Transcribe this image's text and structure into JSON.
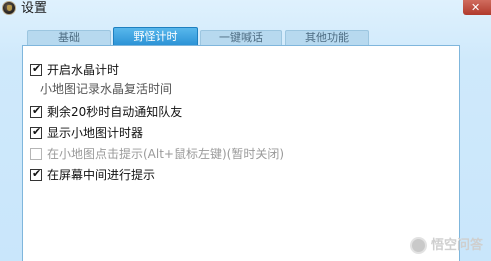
{
  "window": {
    "title": "设置",
    "close_glyph": "✕",
    "icon": "game-app-icon"
  },
  "tabs": [
    {
      "label": "基础",
      "active": false
    },
    {
      "label": "野怪计时",
      "active": true
    },
    {
      "label": "一键喊话",
      "active": false
    },
    {
      "label": "其他功能",
      "active": false
    }
  ],
  "options": [
    {
      "label": "开启水晶计时",
      "checked": true,
      "enabled": true
    },
    {
      "label": "小地图记录水晶复活时间"
    },
    {
      "label": "剩余20秒时自动通知队友",
      "checked": true,
      "enabled": true
    },
    {
      "label": "显示小地图计时器",
      "checked": true,
      "enabled": true
    },
    {
      "label": "在小地图点击提示(Alt+鼠标左键)(暂时关闭)",
      "checked": false,
      "enabled": false
    },
    {
      "label": "在屏幕中间进行提示",
      "checked": true,
      "enabled": true
    }
  ],
  "check_glyph": "✔",
  "watermark": {
    "text": "悟空问答",
    "icon": "wukong-logo-icon"
  },
  "colors": {
    "window_bg": "#cfe9fb",
    "active_tab": "#2c93d6",
    "inactive_tab": "#b7d9ef",
    "panel_border": "#7fb6dc",
    "close_button": "#b03a2c"
  }
}
